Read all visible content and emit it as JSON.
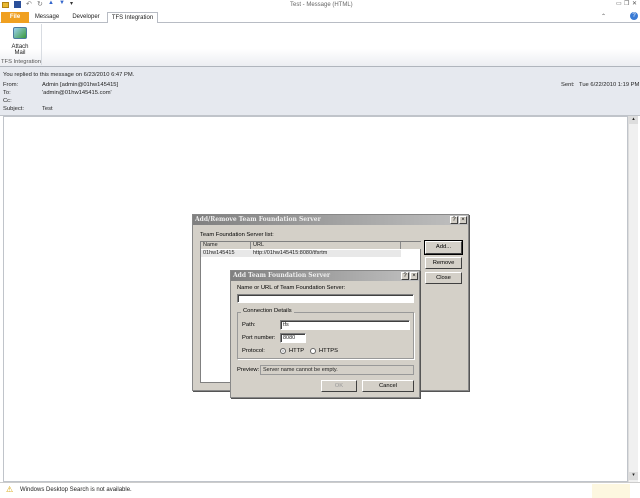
{
  "window": {
    "title": "Test - Message (HTML)"
  },
  "tabs": [
    {
      "label": "File"
    },
    {
      "label": "Message"
    },
    {
      "label": "Developer"
    },
    {
      "label": "TFS Integration"
    }
  ],
  "ribbon": {
    "button_label_1": "Attach",
    "button_label_2": "Mail",
    "group": "TFS Integration"
  },
  "header": {
    "info": "You replied to this message on 6/23/2010 6:47 PM.",
    "from_label": "From:",
    "from": "Admin [admin@01hw145415]",
    "to_label": "To:",
    "to": "'admin@01hw145415.com'",
    "cc_label": "Cc:",
    "subject_label": "Subject:",
    "subject": "Test",
    "sent_label": "Sent:",
    "sent": "Tue 6/22/2010 1:19 PM"
  },
  "outer_dialog": {
    "title": "Add/Remove Team Foundation Server",
    "list_label": "Team Foundation Server list:",
    "columns": [
      "Name",
      "URL"
    ],
    "rows": [
      {
        "name": "01hw145415",
        "url": "http://01hw145415:8080/tfsrtm"
      }
    ],
    "add": "Add...",
    "remove": "Remove",
    "close": "Close"
  },
  "inner_dialog": {
    "title": "Add Team Foundation Server",
    "name_label": "Name or URL of Team Foundation Server:",
    "name_value": "",
    "group": "Connection Details",
    "path_label": "Path:",
    "path_value": "tfs",
    "port_label": "Port number:",
    "port_value": "8080",
    "protocol_label": "Protocol:",
    "http": "HTTP",
    "https": "HTTPS",
    "preview_label": "Preview:",
    "preview_value": "Server name cannot be empty.",
    "ok": "OK",
    "cancel": "Cancel"
  },
  "status": {
    "text": "Windows Desktop Search is not available."
  }
}
